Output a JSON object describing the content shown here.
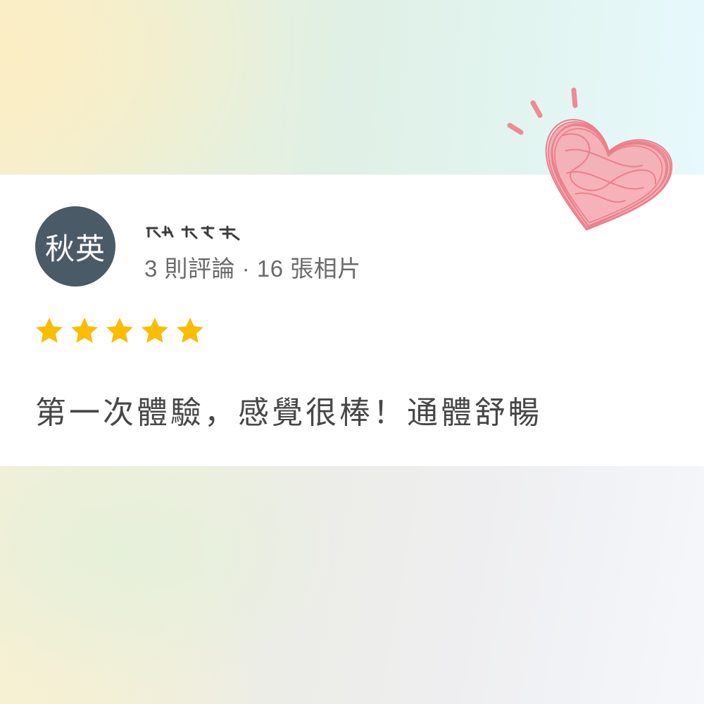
{
  "avatar": {
    "initials": "秋英",
    "bg_color": "#4b5a67"
  },
  "reviewer": {
    "stats": "3 則評論 · 16 張相片"
  },
  "rating": {
    "stars": 5,
    "max": 5,
    "color": "#fbbc04",
    "icon": "star-icon"
  },
  "review": {
    "text": "第一次體驗，感覺很棒！通體舒暢"
  },
  "decoration": {
    "icon": "heart-doodle-icon",
    "color": "#f08c96"
  }
}
